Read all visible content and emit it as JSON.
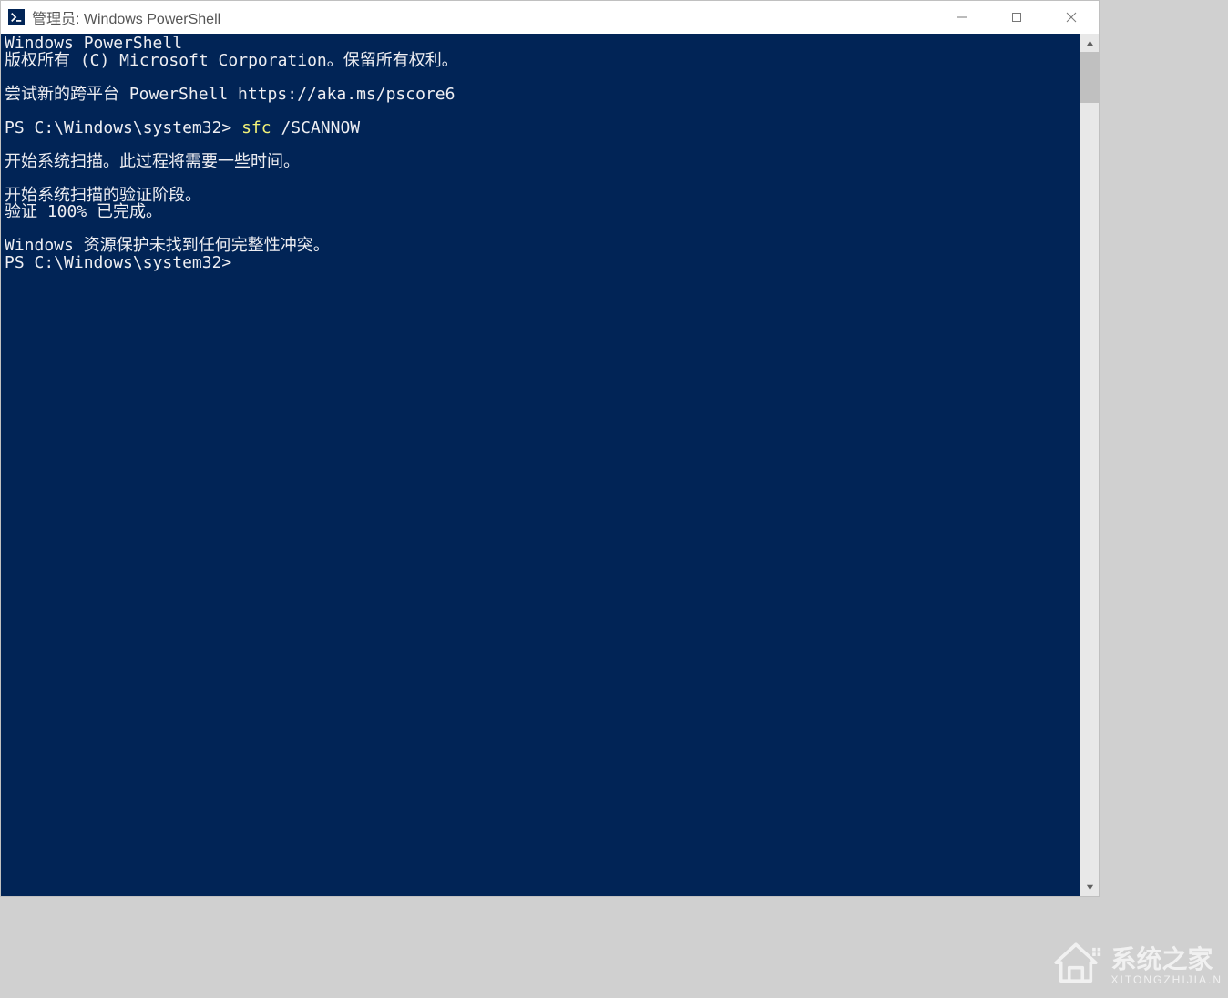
{
  "window": {
    "title": "管理员: Windows PowerShell"
  },
  "console": {
    "line1": "Windows PowerShell",
    "line2": "版权所有 (C) Microsoft Corporation。保留所有权利。",
    "line3": "",
    "line4": "尝试新的跨平台 PowerShell https://aka.ms/pscore6",
    "line5": "",
    "prompt1_prefix": "PS C:\\Windows\\system32> ",
    "prompt1_cmd": "sfc ",
    "prompt1_arg": "/SCANNOW",
    "line7": "",
    "line8": "开始系统扫描。此过程将需要一些时间。",
    "line9": "",
    "line10": "开始系统扫描的验证阶段。",
    "line11": "验证 100% 已完成。",
    "line12": "",
    "line13": "Windows 资源保护未找到任何完整性冲突。",
    "prompt2": "PS C:\\Windows\\system32>"
  },
  "watermark": {
    "main": "系统之家",
    "sub": "XITONGZHIJIA.N"
  }
}
